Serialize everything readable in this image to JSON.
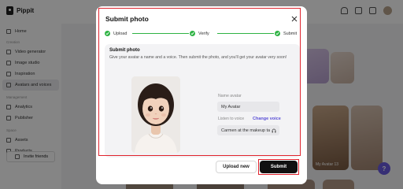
{
  "app": {
    "name": "Pippit"
  },
  "sidebar": {
    "items_top": [
      {
        "label": "Home",
        "icon": "home-icon"
      }
    ],
    "sections": [
      {
        "title": "Creation",
        "items": [
          {
            "label": "Video generator",
            "icon": "video-icon"
          },
          {
            "label": "Image studio",
            "icon": "image-icon"
          },
          {
            "label": "Inspiration",
            "icon": "lightbulb-icon"
          },
          {
            "label": "Avatars and voices",
            "icon": "avatar-icon",
            "active": true
          }
        ]
      },
      {
        "title": "Management",
        "items": [
          {
            "label": "Analytics",
            "icon": "chart-icon"
          },
          {
            "label": "Publisher",
            "icon": "calendar-icon"
          }
        ]
      },
      {
        "title": "Space",
        "items": [
          {
            "label": "Assets",
            "icon": "folder-icon"
          },
          {
            "label": "Products",
            "icon": "box-icon"
          }
        ]
      }
    ],
    "invite_label": "Invite friends"
  },
  "background": {
    "card_label": "My Avatar 13",
    "help_label": "?"
  },
  "modal": {
    "title": "Submit photo",
    "steps": [
      {
        "label": "Upload",
        "done": true
      },
      {
        "label": "Verify",
        "done": true
      },
      {
        "label": "Submit",
        "done": true
      }
    ],
    "panel_title": "Submit photo",
    "panel_desc": "Give your avatar a name and a voice. Then submit the photo, and you'll get your avatar very soon!",
    "name_label": "Name avatar",
    "name_value": "My Avatar",
    "voice_label": "Listen to voice",
    "change_voice": "Change voice",
    "voice_value": "Carmen at the makeup ta",
    "upload_button": "Upload new",
    "submit_button": "Submit"
  },
  "colors": {
    "accent": "#5a4fd6",
    "step_done": "#2fb344",
    "highlight": "#e0242e",
    "primary_button": "#111111"
  }
}
